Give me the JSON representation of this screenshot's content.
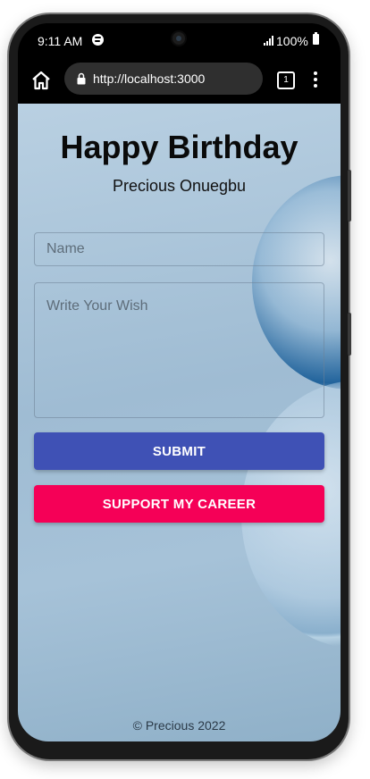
{
  "statusbar": {
    "time": "9:11 AM",
    "battery": "100%"
  },
  "browser": {
    "url": "http://localhost:3000",
    "tab_count": "1"
  },
  "page": {
    "title": "Happy Birthday",
    "subtitle": "Precious Onuegbu",
    "name_placeholder": "Name",
    "wish_placeholder": "Write Your Wish",
    "submit_label": "SUBMIT",
    "support_label": "SUPPORT MY CAREER",
    "footer": "© Precious 2022"
  },
  "colors": {
    "submit": "#3f51b5",
    "support": "#f50057"
  },
  "icons": [
    "spotify-icon",
    "signal-icon",
    "battery-icon",
    "home-icon",
    "lock-icon",
    "tabs-icon",
    "menu-icon"
  ]
}
